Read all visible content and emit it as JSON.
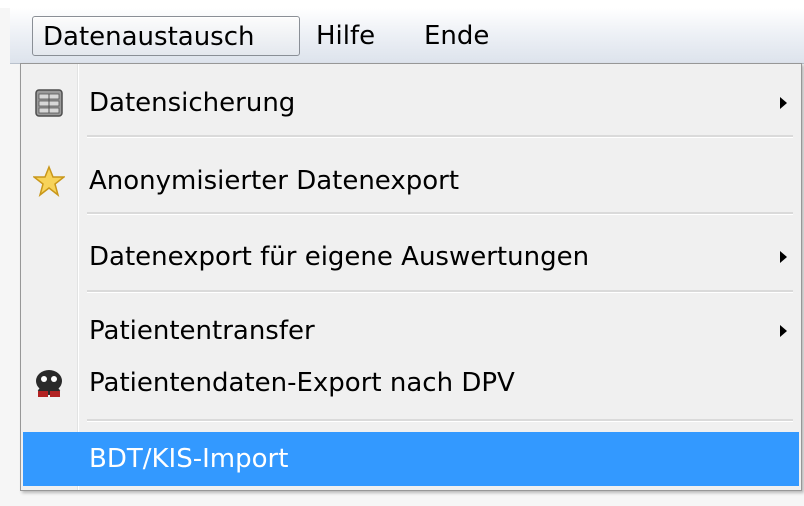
{
  "menubar": {
    "items": [
      {
        "label": "Datenaustausch"
      },
      {
        "label": "Hilfe"
      },
      {
        "label": "Ende"
      }
    ]
  },
  "dropdown": {
    "items": [
      {
        "label": "Datensicherung",
        "icon": "database-icon",
        "submenu": true
      },
      {
        "label": "Anonymisierter Datenexport",
        "icon": "star-icon",
        "submenu": false
      },
      {
        "label": "Datenexport für eigene Auswertungen",
        "icon": "",
        "submenu": true
      },
      {
        "label": "Patiententransfer",
        "icon": "",
        "submenu": true
      },
      {
        "label": "Patientendaten-Export nach DPV",
        "icon": "dpv-logo-icon",
        "submenu": false
      },
      {
        "label": "BDT/KIS-Import",
        "icon": "",
        "submenu": false,
        "highlighted": true
      }
    ]
  },
  "colors": {
    "highlight": "#3399ff",
    "menu_background": "#f0f0f0"
  }
}
